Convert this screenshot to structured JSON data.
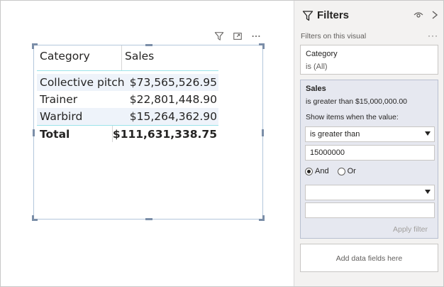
{
  "visual": {
    "header_icons": [
      "filter-icon",
      "focus-mode-icon",
      "more-options-icon"
    ],
    "table": {
      "columns": [
        "Category",
        "Sales"
      ],
      "rows": [
        {
          "category": "Collective pitch",
          "sales": "$73,565,526.95"
        },
        {
          "category": "Trainer",
          "sales": "$22,801,448.90"
        },
        {
          "category": "Warbird",
          "sales": "$15,264,362.90"
        }
      ],
      "total": {
        "label": "Total",
        "sales": "$111,631,338.75"
      }
    }
  },
  "filters_pane": {
    "title": "Filters",
    "section_label": "Filters on this visual",
    "more": "···",
    "category_card": {
      "title": "Category",
      "state": "is (All)"
    },
    "sales_card": {
      "title": "Sales",
      "state": "is greater than $15,000,000.00",
      "show_items_label": "Show items when the value:",
      "operator1": "is greater than",
      "value1": "15000000",
      "logic_and": "And",
      "logic_or": "Or",
      "logic_selected": "And",
      "operator2": "",
      "value2": "",
      "apply_label": "Apply filter"
    },
    "add_fields_label": "Add data fields here"
  },
  "colors": {
    "accent_line": "#9ae3ea",
    "pane_bg": "#f3f2f1",
    "active_card_bg": "#e6e8f0",
    "selection_border": "#7b8ea8"
  }
}
